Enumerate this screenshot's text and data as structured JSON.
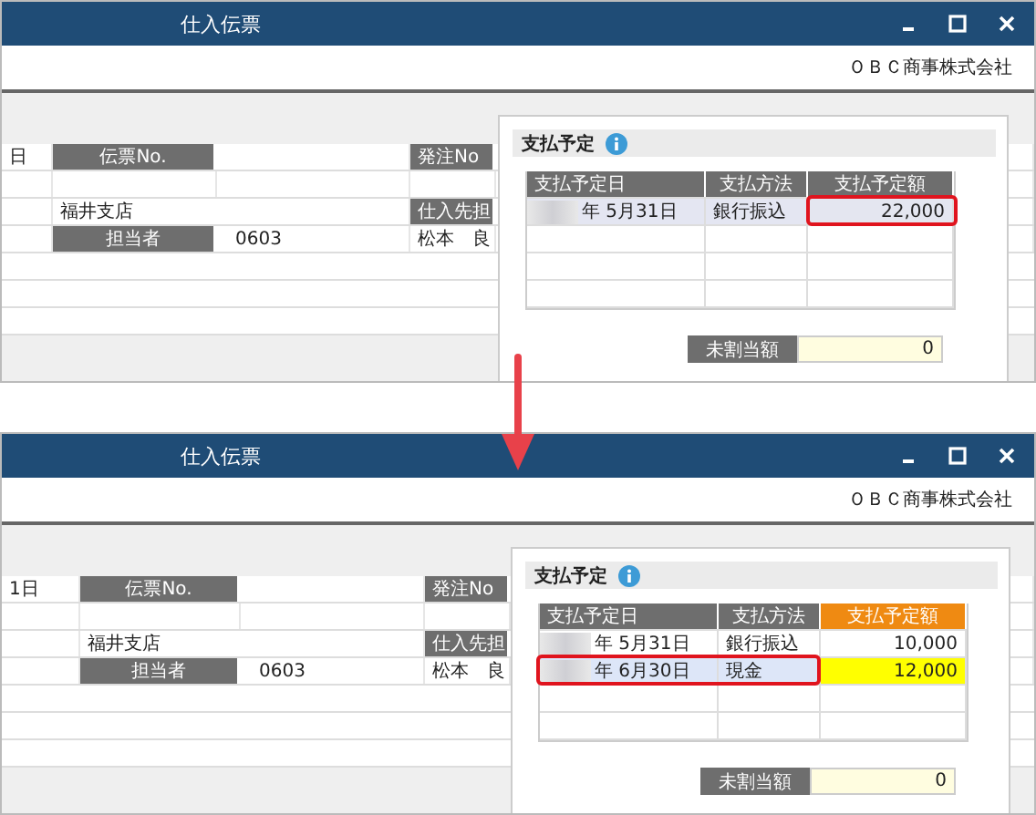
{
  "panels": [
    {
      "title": "仕入伝票",
      "company": "ＯＢＣ商事株式会社",
      "form": {
        "date_fragment": "日",
        "slip_no_label": "伝票No.",
        "order_no_label": "発注No",
        "branch": "福井支店",
        "supplier_contact_label": "仕入先担",
        "staff_label": "担当者",
        "staff_code": "0603",
        "supplier_contact": "松本　良"
      },
      "popup": {
        "title": "支払予定",
        "columns": [
          {
            "label": "支払予定日",
            "highlighted": false
          },
          {
            "label": "支払方法",
            "highlighted": false
          },
          {
            "label": "支払予定額",
            "highlighted": false
          }
        ],
        "rows": [
          {
            "date": "年  5月31日",
            "method": "銀行振込",
            "amount": "22,000",
            "selected": true,
            "editing": false,
            "frame_amount": true,
            "frame_date_method": false
          }
        ],
        "unallocated_label": "未割当額",
        "unallocated_value": "0"
      }
    },
    {
      "title": "仕入伝票",
      "company": "ＯＢＣ商事株式会社",
      "form": {
        "date_fragment": "1日",
        "slip_no_label": "伝票No.",
        "order_no_label": "発注No",
        "branch": "福井支店",
        "supplier_contact_label": "仕入先担",
        "staff_label": "担当者",
        "staff_code": "0603",
        "supplier_contact": "松本　良"
      },
      "popup": {
        "title": "支払予定",
        "columns": [
          {
            "label": "支払予定日",
            "highlighted": false
          },
          {
            "label": "支払方法",
            "highlighted": false
          },
          {
            "label": "支払予定額",
            "highlighted": true
          }
        ],
        "rows": [
          {
            "date": "年  5月31日",
            "method": "銀行振込",
            "amount": "10,000",
            "selected": false,
            "editing": false,
            "frame_amount": false,
            "frame_date_method": false
          },
          {
            "date": "年  6月30日",
            "method": "現金",
            "amount": "12,000",
            "selected": true,
            "editing": true,
            "frame_amount": false,
            "frame_date_method": true
          }
        ],
        "unallocated_label": "未割当額",
        "unallocated_value": "0"
      }
    }
  ]
}
